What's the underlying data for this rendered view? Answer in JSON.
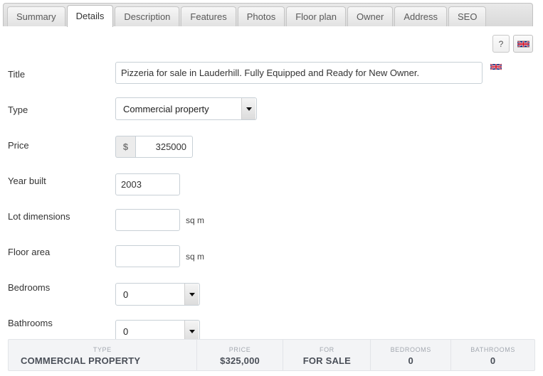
{
  "tabs": [
    {
      "label": "Summary",
      "active": false
    },
    {
      "label": "Details",
      "active": true
    },
    {
      "label": "Description",
      "active": false
    },
    {
      "label": "Features",
      "active": false
    },
    {
      "label": "Photos",
      "active": false
    },
    {
      "label": "Floor plan",
      "active": false
    },
    {
      "label": "Owner",
      "active": false
    },
    {
      "label": "Address",
      "active": false
    },
    {
      "label": "SEO",
      "active": false
    }
  ],
  "toolbar": {
    "help_label": "?",
    "language_icon": "uk-flag-icon"
  },
  "form": {
    "title": {
      "label": "Title",
      "value": "Pizzeria for sale in Lauderhill. Fully Equipped and Ready for New Owner.",
      "flag_icon": "uk-flag-icon"
    },
    "type": {
      "label": "Type",
      "value": "Commercial property"
    },
    "price": {
      "label": "Price",
      "currency_symbol": "$",
      "value": "325000"
    },
    "year_built": {
      "label": "Year built",
      "value": "2003"
    },
    "lot_dimensions": {
      "label": "Lot dimensions",
      "value": "",
      "unit": "sq m"
    },
    "floor_area": {
      "label": "Floor area",
      "value": "",
      "unit": "sq m"
    },
    "bedrooms": {
      "label": "Bedrooms",
      "value": "0"
    },
    "bathrooms": {
      "label": "Bathrooms",
      "value": "0"
    }
  },
  "footer": {
    "cells": [
      {
        "head": "TYPE",
        "value": "COMMERCIAL PROPERTY"
      },
      {
        "head": "PRICE",
        "value": "$325,000"
      },
      {
        "head": "FOR",
        "value": "FOR SALE"
      },
      {
        "head": "BEDROOMS",
        "value": "0"
      },
      {
        "head": "BATHROOMS",
        "value": "0"
      }
    ]
  },
  "colors": {
    "active_tab_bg": "#ffffff",
    "tabbar_bg": "#e4e4e4",
    "footer_bg": "#f3f4f6",
    "footer_head": "#a3a8b0",
    "footer_value": "#4a4f58"
  }
}
